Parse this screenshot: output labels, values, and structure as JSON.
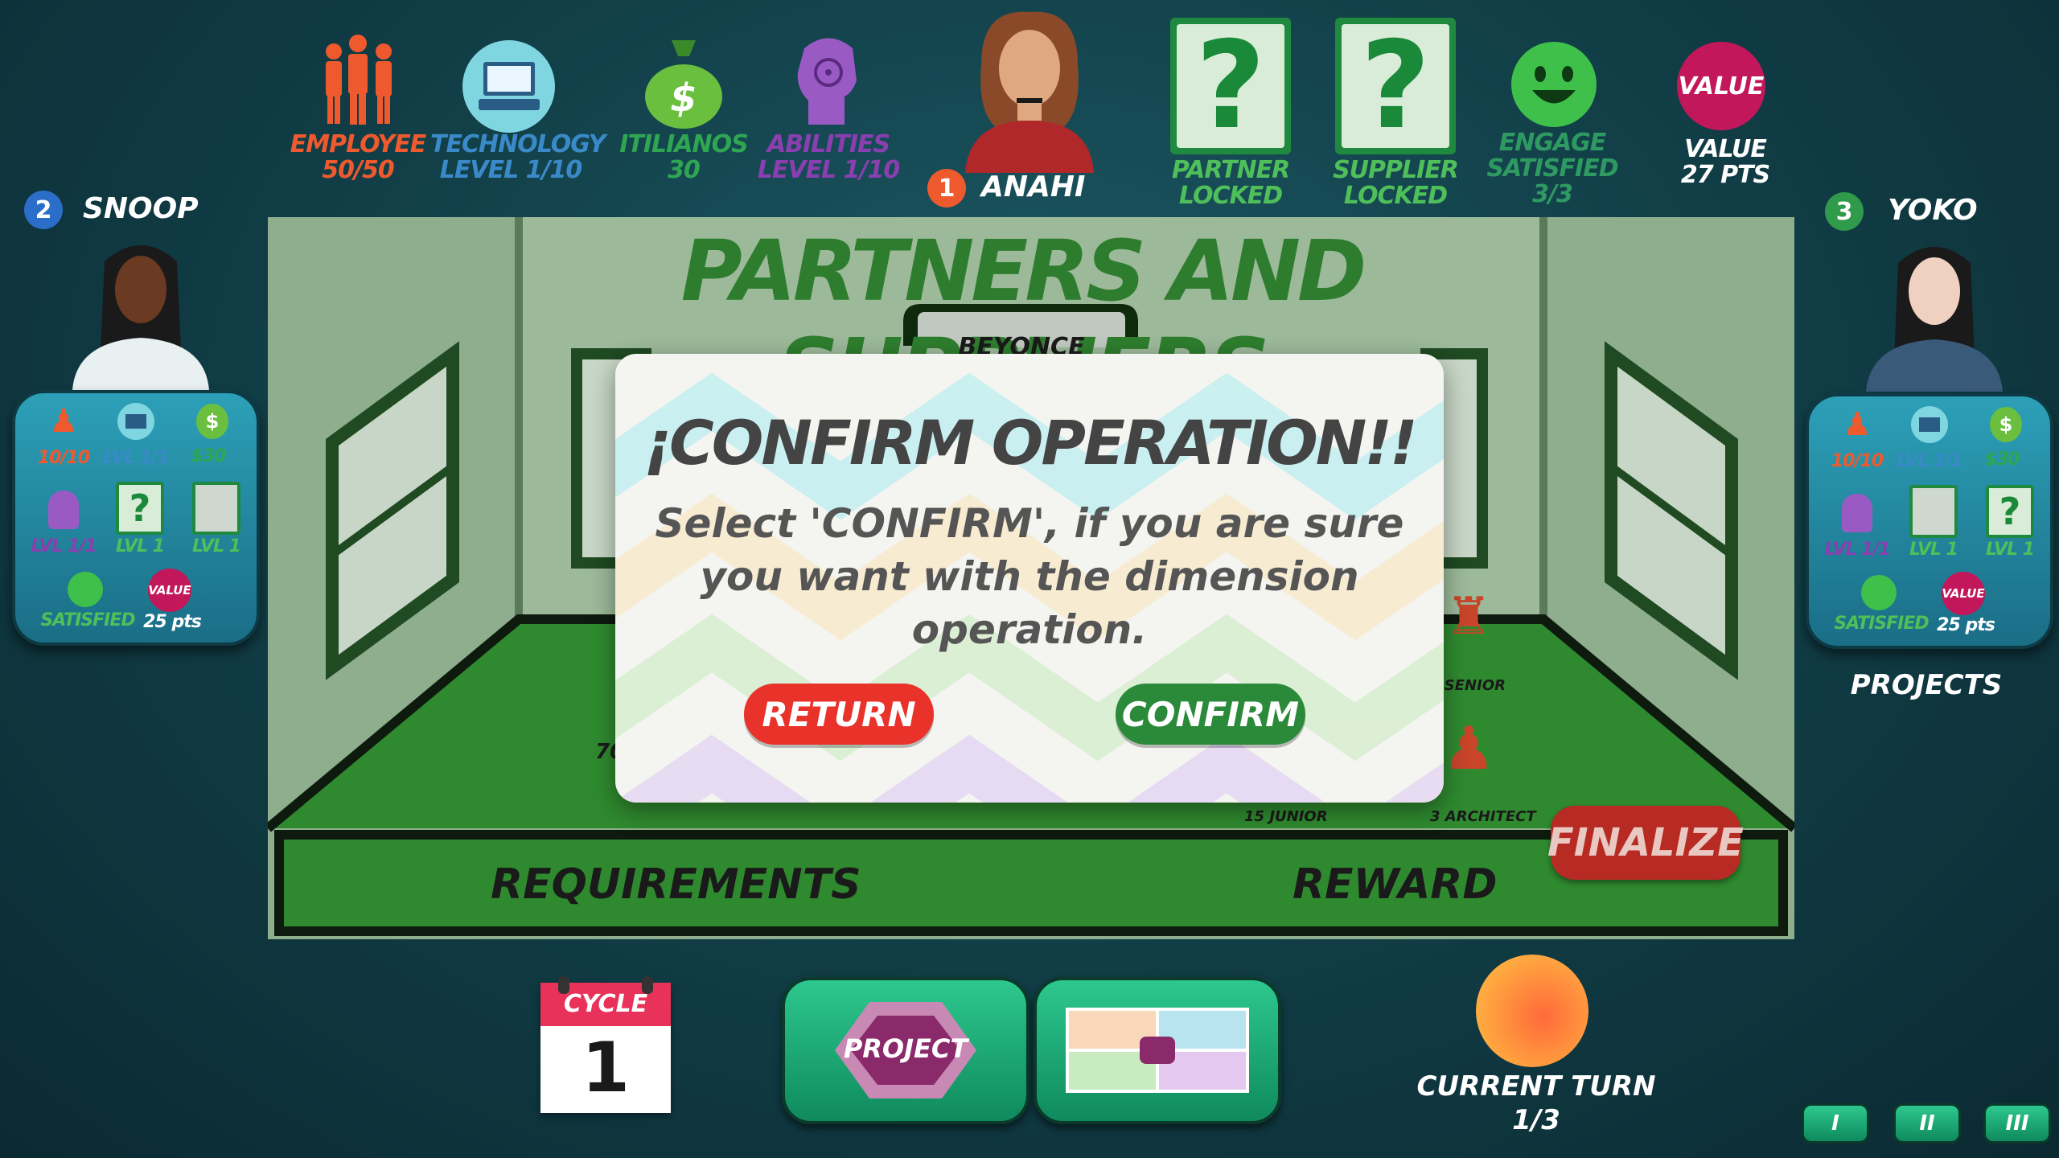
{
  "top_stats": {
    "employee": {
      "label": "EMPLOYEE",
      "value": "50/50",
      "icon": "employees-icon"
    },
    "technology": {
      "label": "TECHNOLOGY",
      "value": "LEVEL  1/10",
      "icon": "computer-icon"
    },
    "itilianos": {
      "label": "ITILIANOS",
      "value": "30",
      "icon": "money-bag-icon"
    },
    "abilities": {
      "label": "ABILITIES",
      "value": "LEVEL  1/10",
      "icon": "brain-head-icon"
    }
  },
  "current_player": {
    "number": "1",
    "name": "ANAHI"
  },
  "partner": {
    "label": "PARTNER",
    "status": "LOCKED",
    "symbol": "?"
  },
  "supplier": {
    "label": "SUPPLIER",
    "status": "LOCKED",
    "symbol": "?"
  },
  "engage": {
    "label": "ENGAGE",
    "status": "SATISFIED",
    "value": "3/3"
  },
  "value_badge": {
    "badge": "VALUE",
    "label": "VALUE",
    "points": "27 PTS"
  },
  "player_left": {
    "number": "2",
    "name": "SNOOP",
    "employees": "10/10",
    "tech": "LVL 1/1",
    "money": "$30",
    "abilities": "LVL 1/1",
    "partner": "LVL 1",
    "supplier": "LVL 1",
    "satisfied": "SATISFIED",
    "value_badge": "VALUE",
    "points": "25 pts"
  },
  "player_right": {
    "number": "3",
    "name": "YOKO",
    "employees": "10/10",
    "tech": "LVL 1/1",
    "money": "$30",
    "abilities": "LVL 1/1",
    "partner": "LVL 1",
    "supplier": "LVL 1",
    "satisfied": "SATISFIED",
    "value_badge": "VALUE",
    "points": "25 pts",
    "projects_label": "PROJECTS"
  },
  "board": {
    "title": "PARTNERS AND SUPPLIERS",
    "sign": "BEYONCE",
    "requirements": "REQUIREMENTS",
    "reward": "REWARD",
    "finalize": "FINALIZE",
    "partial_number": "70",
    "senior_label": "5 SENIOR",
    "junior_label": "15 JUNIOR",
    "architect_label": "3 ARCHITECT"
  },
  "modal": {
    "title": "¡CONFIRM OPERATION!!",
    "message_line1": "Select 'CONFIRM', if you are sure",
    "message_line2": "you want with the dimension",
    "message_line3": "operation.",
    "return_label": "RETURN",
    "confirm_label": "CONFIRM"
  },
  "cycle": {
    "label": "CYCLE",
    "value": "1"
  },
  "project_button": {
    "label": "PROJECT"
  },
  "current_turn": {
    "label": "CURRENT TURN",
    "value": "1/3"
  },
  "page_buttons": [
    "I",
    "II",
    "III"
  ],
  "colors": {
    "accent_green": "#1f8a3f",
    "return_red": "#e8322a",
    "finalize_red": "#b82a24",
    "value_magenta": "#c2185b"
  }
}
